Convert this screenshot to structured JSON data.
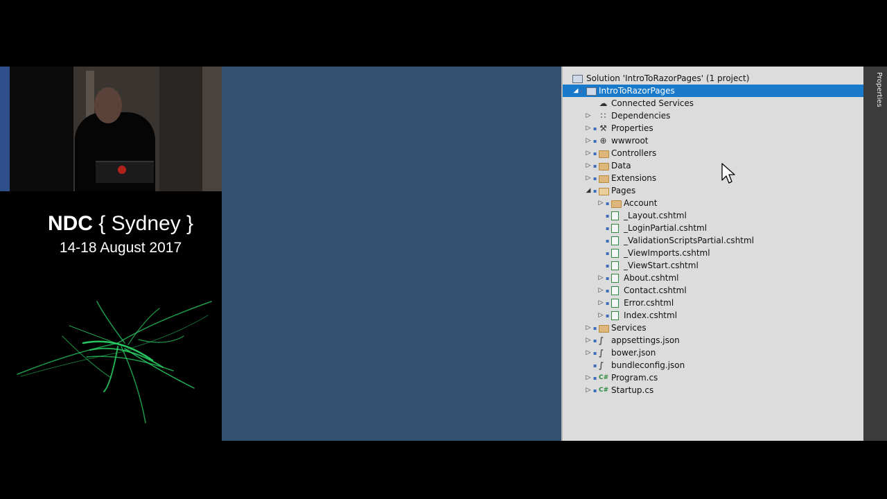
{
  "event": {
    "brand": "NDC",
    "city_open": "{ Sydney }",
    "dates": "14-18 August 2017"
  },
  "side_tab": {
    "label": "Properties"
  },
  "explorer": {
    "solution": "Solution 'IntroToRazorPages' (1 project)",
    "items": [
      {
        "label": "IntroToRazorPages",
        "icon": "project-icon",
        "level": 0,
        "arrow": "expanded",
        "locked": true,
        "selected": true
      },
      {
        "label": "Connected Services",
        "icon": "cloud-icon",
        "level": 1,
        "arrow": "none",
        "locked": false
      },
      {
        "label": "Dependencies",
        "icon": "dependencies-icon",
        "level": 1,
        "arrow": "collapsed",
        "locked": false
      },
      {
        "label": "Properties",
        "icon": "wrench-icon",
        "level": 1,
        "arrow": "collapsed",
        "locked": true
      },
      {
        "label": "wwwroot",
        "icon": "globe-icon",
        "level": 1,
        "arrow": "collapsed",
        "locked": true
      },
      {
        "label": "Controllers",
        "icon": "folder-icon",
        "level": 1,
        "arrow": "collapsed",
        "locked": true
      },
      {
        "label": "Data",
        "icon": "folder-icon",
        "level": 1,
        "arrow": "collapsed",
        "locked": true
      },
      {
        "label": "Extensions",
        "icon": "folder-icon",
        "level": 1,
        "arrow": "collapsed",
        "locked": true
      },
      {
        "label": "Pages",
        "icon": "folder-open-icon",
        "level": 1,
        "arrow": "expanded",
        "locked": true
      },
      {
        "label": "Account",
        "icon": "folder-icon",
        "level": 2,
        "arrow": "collapsed",
        "locked": true
      },
      {
        "label": "_Layout.cshtml",
        "icon": "razor-file-icon",
        "level": 2,
        "arrow": "none",
        "locked": true
      },
      {
        "label": "_LoginPartial.cshtml",
        "icon": "razor-file-icon",
        "level": 2,
        "arrow": "none",
        "locked": true
      },
      {
        "label": "_ValidationScriptsPartial.cshtml",
        "icon": "razor-file-icon",
        "level": 2,
        "arrow": "none",
        "locked": true
      },
      {
        "label": "_ViewImports.cshtml",
        "icon": "razor-file-icon",
        "level": 2,
        "arrow": "none",
        "locked": true
      },
      {
        "label": "_ViewStart.cshtml",
        "icon": "razor-file-icon",
        "level": 2,
        "arrow": "none",
        "locked": true
      },
      {
        "label": "About.cshtml",
        "icon": "razor-file-icon",
        "level": 2,
        "arrow": "collapsed",
        "locked": true
      },
      {
        "label": "Contact.cshtml",
        "icon": "razor-file-icon",
        "level": 2,
        "arrow": "collapsed",
        "locked": true
      },
      {
        "label": "Error.cshtml",
        "icon": "razor-file-icon",
        "level": 2,
        "arrow": "collapsed",
        "locked": true
      },
      {
        "label": "Index.cshtml",
        "icon": "razor-file-icon",
        "level": 2,
        "arrow": "collapsed",
        "locked": true
      },
      {
        "label": "Services",
        "icon": "folder-icon",
        "level": 1,
        "arrow": "collapsed",
        "locked": true
      },
      {
        "label": "appsettings.json",
        "icon": "json-file-icon",
        "level": 1,
        "arrow": "collapsed",
        "locked": true
      },
      {
        "label": "bower.json",
        "icon": "json-file-icon",
        "level": 1,
        "arrow": "collapsed",
        "locked": true
      },
      {
        "label": "bundleconfig.json",
        "icon": "json-file-icon",
        "level": 1,
        "arrow": "none",
        "locked": true
      },
      {
        "label": "Program.cs",
        "icon": "csharp-file-icon",
        "level": 1,
        "arrow": "collapsed",
        "locked": true
      },
      {
        "label": "Startup.cs",
        "icon": "csharp-file-icon",
        "level": 1,
        "arrow": "collapsed",
        "locked": true
      }
    ]
  },
  "colors": {
    "slide_bg": "#34506f",
    "explorer_bg": "#dcdcdc",
    "selection": "#1979ca",
    "logo_green": "#2bd96a"
  }
}
